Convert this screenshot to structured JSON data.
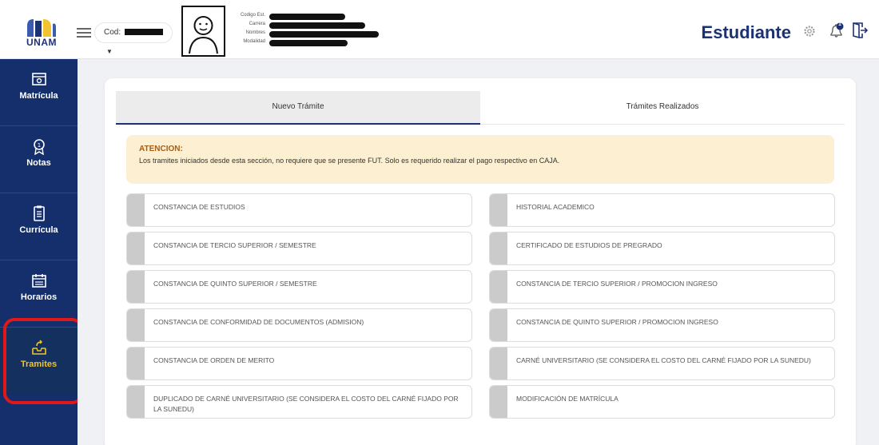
{
  "header": {
    "logo_text": "UNAM",
    "cod_label": "Cod:",
    "info_labels": [
      "Codigo Est.",
      "Carrera",
      "Nombres",
      "Modalidad"
    ],
    "role_title": "Estudiante",
    "icons": [
      "menu-icon",
      "gear-icon",
      "bell-icon",
      "logout-icon"
    ],
    "notification_count": "1"
  },
  "sidebar": {
    "items": [
      {
        "label": "Matrícula",
        "icon": "wallet-icon"
      },
      {
        "label": "Notas",
        "icon": "medal-icon"
      },
      {
        "label": "Currícula",
        "icon": "document-icon"
      },
      {
        "label": "Horarios",
        "icon": "calendar-icon"
      },
      {
        "label": "Tramites",
        "icon": "inbox-upload-icon"
      }
    ],
    "active": "Tramites"
  },
  "tabs": [
    {
      "label": "Nuevo Trámite",
      "active": true
    },
    {
      "label": "Trámites Realizados",
      "active": false
    }
  ],
  "alert": {
    "title": "ATENCION:",
    "text": "Los tramites iniciados desde esta sección, no requiere que se presente FUT. Solo es requerido realizar el pago respectivo en CAJA."
  },
  "procedures": {
    "left": [
      "CONSTANCIA DE ESTUDIOS",
      "CONSTANCIA DE TERCIO SUPERIOR / SEMESTRE",
      "CONSTANCIA DE QUINTO SUPERIOR / SEMESTRE",
      "CONSTANCIA DE CONFORMIDAD DE DOCUMENTOS (ADMISION)",
      "CONSTANCIA DE ORDEN DE MERITO",
      "DUPLICADO DE CARNÉ UNIVERSITARIO (SE CONSIDERA EL COSTO DEL CARNÉ FIJADO POR LA SUNEDU)"
    ],
    "right": [
      "HISTORIAL ACADEMICO",
      "CERTIFICADO DE ESTUDIOS DE PREGRADO",
      "CONSTANCIA DE TERCIO SUPERIOR / PROMOCION INGRESO",
      "CONSTANCIA DE QUINTO SUPERIOR / PROMOCION INGRESO",
      "CARNÉ UNIVERSITARIO (SE CONSIDERA EL COSTO DEL CARNÉ FIJADO POR LA SUNEDU)",
      "MODIFICACIÓN DE MATRÍCULA"
    ]
  },
  "colors": {
    "primary": "#1d3273",
    "sidebar": "#142f6b",
    "active_text": "#f2c230",
    "alert_bg": "#fdf0d2",
    "alert_title": "#a65c12",
    "highlight": "#e01818"
  }
}
